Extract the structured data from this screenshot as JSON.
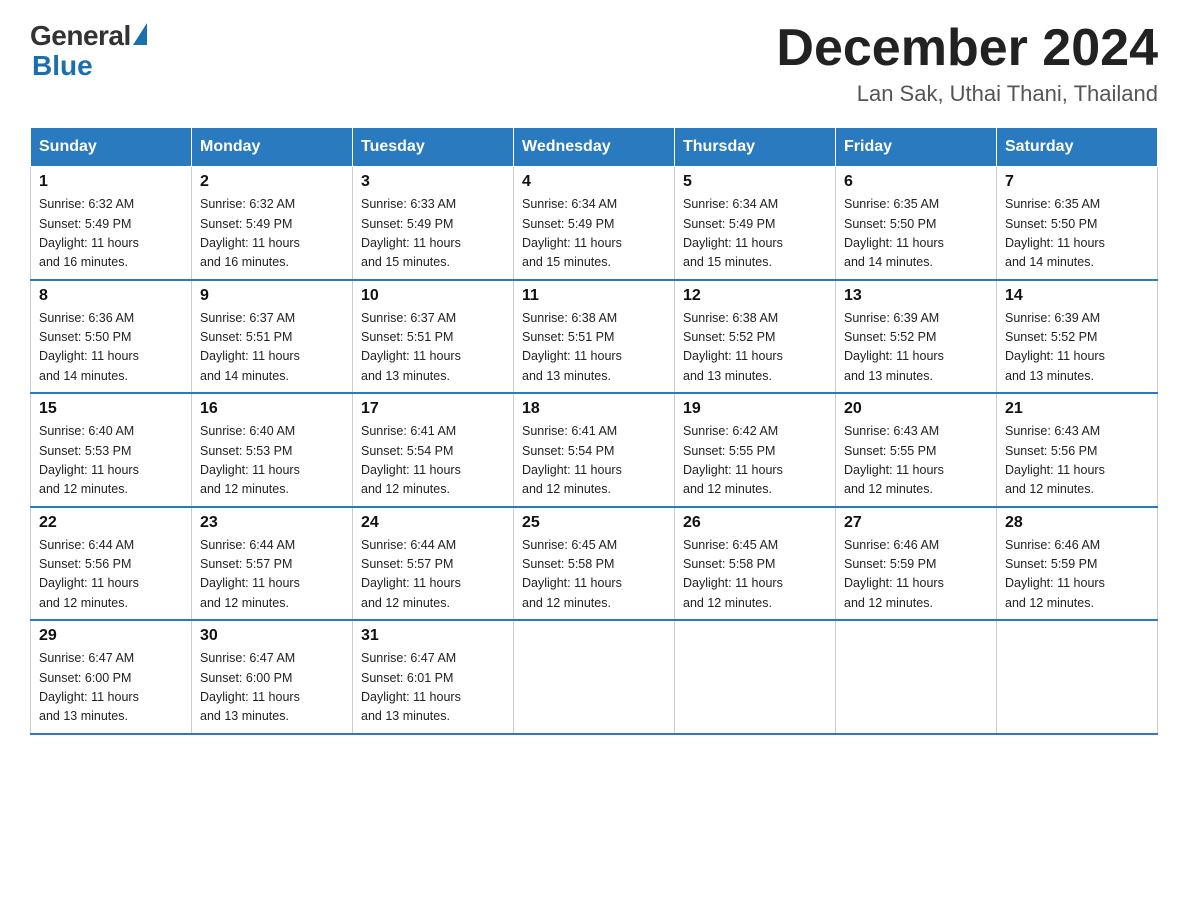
{
  "header": {
    "logo_general": "General",
    "logo_blue": "Blue",
    "month_year": "December 2024",
    "location": "Lan Sak, Uthai Thani, Thailand"
  },
  "weekdays": [
    "Sunday",
    "Monday",
    "Tuesday",
    "Wednesday",
    "Thursday",
    "Friday",
    "Saturday"
  ],
  "weeks": [
    [
      {
        "day": "1",
        "sunrise": "6:32 AM",
        "sunset": "5:49 PM",
        "daylight": "11 hours and 16 minutes."
      },
      {
        "day": "2",
        "sunrise": "6:32 AM",
        "sunset": "5:49 PM",
        "daylight": "11 hours and 16 minutes."
      },
      {
        "day": "3",
        "sunrise": "6:33 AM",
        "sunset": "5:49 PM",
        "daylight": "11 hours and 15 minutes."
      },
      {
        "day": "4",
        "sunrise": "6:34 AM",
        "sunset": "5:49 PM",
        "daylight": "11 hours and 15 minutes."
      },
      {
        "day": "5",
        "sunrise": "6:34 AM",
        "sunset": "5:49 PM",
        "daylight": "11 hours and 15 minutes."
      },
      {
        "day": "6",
        "sunrise": "6:35 AM",
        "sunset": "5:50 PM",
        "daylight": "11 hours and 14 minutes."
      },
      {
        "day": "7",
        "sunrise": "6:35 AM",
        "sunset": "5:50 PM",
        "daylight": "11 hours and 14 minutes."
      }
    ],
    [
      {
        "day": "8",
        "sunrise": "6:36 AM",
        "sunset": "5:50 PM",
        "daylight": "11 hours and 14 minutes."
      },
      {
        "day": "9",
        "sunrise": "6:37 AM",
        "sunset": "5:51 PM",
        "daylight": "11 hours and 14 minutes."
      },
      {
        "day": "10",
        "sunrise": "6:37 AM",
        "sunset": "5:51 PM",
        "daylight": "11 hours and 13 minutes."
      },
      {
        "day": "11",
        "sunrise": "6:38 AM",
        "sunset": "5:51 PM",
        "daylight": "11 hours and 13 minutes."
      },
      {
        "day": "12",
        "sunrise": "6:38 AM",
        "sunset": "5:52 PM",
        "daylight": "11 hours and 13 minutes."
      },
      {
        "day": "13",
        "sunrise": "6:39 AM",
        "sunset": "5:52 PM",
        "daylight": "11 hours and 13 minutes."
      },
      {
        "day": "14",
        "sunrise": "6:39 AM",
        "sunset": "5:52 PM",
        "daylight": "11 hours and 13 minutes."
      }
    ],
    [
      {
        "day": "15",
        "sunrise": "6:40 AM",
        "sunset": "5:53 PM",
        "daylight": "11 hours and 12 minutes."
      },
      {
        "day": "16",
        "sunrise": "6:40 AM",
        "sunset": "5:53 PM",
        "daylight": "11 hours and 12 minutes."
      },
      {
        "day": "17",
        "sunrise": "6:41 AM",
        "sunset": "5:54 PM",
        "daylight": "11 hours and 12 minutes."
      },
      {
        "day": "18",
        "sunrise": "6:41 AM",
        "sunset": "5:54 PM",
        "daylight": "11 hours and 12 minutes."
      },
      {
        "day": "19",
        "sunrise": "6:42 AM",
        "sunset": "5:55 PM",
        "daylight": "11 hours and 12 minutes."
      },
      {
        "day": "20",
        "sunrise": "6:43 AM",
        "sunset": "5:55 PM",
        "daylight": "11 hours and 12 minutes."
      },
      {
        "day": "21",
        "sunrise": "6:43 AM",
        "sunset": "5:56 PM",
        "daylight": "11 hours and 12 minutes."
      }
    ],
    [
      {
        "day": "22",
        "sunrise": "6:44 AM",
        "sunset": "5:56 PM",
        "daylight": "11 hours and 12 minutes."
      },
      {
        "day": "23",
        "sunrise": "6:44 AM",
        "sunset": "5:57 PM",
        "daylight": "11 hours and 12 minutes."
      },
      {
        "day": "24",
        "sunrise": "6:44 AM",
        "sunset": "5:57 PM",
        "daylight": "11 hours and 12 minutes."
      },
      {
        "day": "25",
        "sunrise": "6:45 AM",
        "sunset": "5:58 PM",
        "daylight": "11 hours and 12 minutes."
      },
      {
        "day": "26",
        "sunrise": "6:45 AM",
        "sunset": "5:58 PM",
        "daylight": "11 hours and 12 minutes."
      },
      {
        "day": "27",
        "sunrise": "6:46 AM",
        "sunset": "5:59 PM",
        "daylight": "11 hours and 12 minutes."
      },
      {
        "day": "28",
        "sunrise": "6:46 AM",
        "sunset": "5:59 PM",
        "daylight": "11 hours and 12 minutes."
      }
    ],
    [
      {
        "day": "29",
        "sunrise": "6:47 AM",
        "sunset": "6:00 PM",
        "daylight": "11 hours and 13 minutes."
      },
      {
        "day": "30",
        "sunrise": "6:47 AM",
        "sunset": "6:00 PM",
        "daylight": "11 hours and 13 minutes."
      },
      {
        "day": "31",
        "sunrise": "6:47 AM",
        "sunset": "6:01 PM",
        "daylight": "11 hours and 13 minutes."
      },
      null,
      null,
      null,
      null
    ]
  ],
  "labels": {
    "sunrise": "Sunrise:",
    "sunset": "Sunset:",
    "daylight": "Daylight:"
  }
}
